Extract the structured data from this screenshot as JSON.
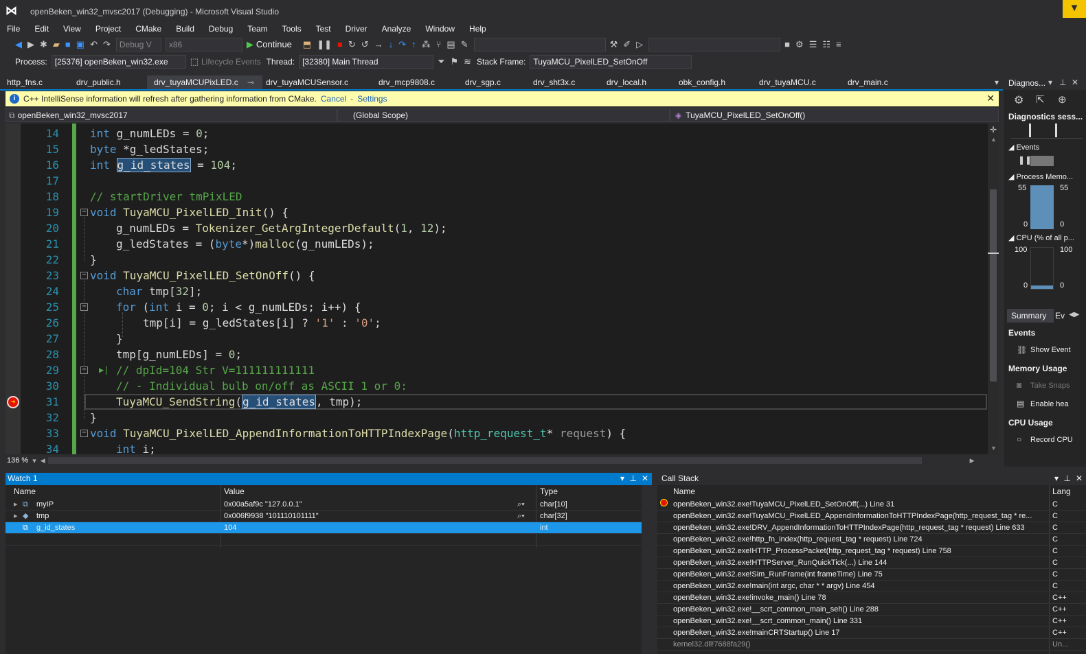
{
  "titlebar": {
    "title": "openBeken_win32_mvsc2017 (Debugging) - Microsoft Visual Studio",
    "notification_icon": "flag-icon"
  },
  "menu": [
    "File",
    "Edit",
    "View",
    "Project",
    "CMake",
    "Build",
    "Debug",
    "Team",
    "Tools",
    "Test",
    "Driver",
    "Analyze",
    "Window",
    "Help"
  ],
  "toolbar": {
    "config": "Debug V",
    "platform": "x86",
    "continue_label": "Continue"
  },
  "debug_location": {
    "process_label": "Process:",
    "process_value": "[25376] openBeken_win32.exe",
    "lifecycle_label": "Lifecycle Events",
    "thread_label": "Thread:",
    "thread_value": "[32380] Main Thread",
    "stack_frame_label": "Stack Frame:",
    "stack_frame_value": "TuyaMCU_PixelLED_SetOnOff"
  },
  "tabs": [
    {
      "label": "http_fns.c",
      "active": false
    },
    {
      "label": "drv_public.h",
      "active": false
    },
    {
      "label": "drv_tuyaMCUPixLED.c",
      "active": true
    },
    {
      "label": "drv_tuyaMCUSensor.c",
      "active": false
    },
    {
      "label": "drv_mcp9808.c",
      "active": false
    },
    {
      "label": "drv_sgp.c",
      "active": false
    },
    {
      "label": "drv_sht3x.c",
      "active": false
    },
    {
      "label": "drv_local.h",
      "active": false
    },
    {
      "label": "obk_config.h",
      "active": false
    },
    {
      "label": "drv_tuyaMCU.c",
      "active": false
    },
    {
      "label": "drv_main.c",
      "active": false
    }
  ],
  "infobar": {
    "message": "C++ IntelliSense information will refresh after gathering information from CMake.",
    "cancel": "Cancel",
    "settings": "Settings"
  },
  "navbar": {
    "project": "openBeken_win32_mvsc2017",
    "scope": "(Global Scope)",
    "member": "TuyaMCU_PixelLED_SetOnOff()"
  },
  "editor": {
    "line_numbers": [
      "14",
      "15",
      "16",
      "17",
      "18",
      "19",
      "20",
      "21",
      "22",
      "23",
      "24",
      "25",
      "26",
      "27",
      "28",
      "29",
      "30",
      "31",
      "32",
      "33",
      "34"
    ],
    "current_line": "31",
    "zoom": "136 %"
  },
  "diagnostics": {
    "title": "Diagnos...",
    "sessions": "Diagnostics sess...",
    "events": "Events",
    "process_memory": "Process Memo...",
    "mem_left_top": "55",
    "mem_right_top": "55",
    "mem_left_bottom": "0",
    "mem_right_bottom": "0",
    "cpu": "CPU (% of all p...",
    "cpu_left_top": "100",
    "cpu_right_top": "100",
    "cpu_left_bottom": "0",
    "cpu_right_bottom": "0",
    "tab_summary": "Summary",
    "tab_events": "Ev",
    "events_heading": "Events",
    "show_events": "Show Event",
    "memory_heading": "Memory Usage",
    "take_snapshot": "Take Snaps",
    "enable_heap": "Enable hea",
    "cpu_heading": "CPU Usage",
    "record_cpu": "Record CPU"
  },
  "watch": {
    "title": "Watch 1",
    "columns": [
      "Name",
      "Value",
      "Type"
    ],
    "rows": [
      {
        "name": "myIP",
        "value": "0x00a5af9c \"127.0.0.1\"",
        "type": "char[10]"
      },
      {
        "name": "tmp",
        "value": "0x006f9938 \"101110101111\"",
        "type": "char[32]"
      },
      {
        "name": "g_id_states",
        "value": "104",
        "type": "int"
      }
    ]
  },
  "callstack": {
    "title": "Call Stack",
    "columns": [
      "Name",
      "Lang"
    ],
    "rows": [
      {
        "name": "openBeken_win32.exe!TuyaMCU_PixelLED_SetOnOff(...) Line 31",
        "lang": "C"
      },
      {
        "name": "openBeken_win32.exe!TuyaMCU_PixelLED_AppendInformationToHTTPIndexPage(http_request_tag * re...",
        "lang": "C"
      },
      {
        "name": "openBeken_win32.exe!DRV_AppendInformationToHTTPIndexPage(http_request_tag * request) Line 633",
        "lang": "C"
      },
      {
        "name": "openBeken_win32.exe!http_fn_index(http_request_tag * request) Line 724",
        "lang": "C"
      },
      {
        "name": "openBeken_win32.exe!HTTP_ProcessPacket(http_request_tag * request) Line 758",
        "lang": "C"
      },
      {
        "name": "openBeken_win32.exe!HTTPServer_RunQuickTick(...) Line 144",
        "lang": "C"
      },
      {
        "name": "openBeken_win32.exe!Sim_RunFrame(int frameTime) Line 75",
        "lang": "C"
      },
      {
        "name": "openBeken_win32.exe!main(int argc, char * * argv) Line 454",
        "lang": "C"
      },
      {
        "name": "openBeken_win32.exe!invoke_main() Line 78",
        "lang": "C++"
      },
      {
        "name": "openBeken_win32.exe!__scrt_common_main_seh() Line 288",
        "lang": "C++"
      },
      {
        "name": "openBeken_win32.exe!__scrt_common_main() Line 331",
        "lang": "C++"
      },
      {
        "name": "openBeken_win32.exe!mainCRTStartup() Line 17",
        "lang": "C++"
      },
      {
        "name": "kernel32.dll!7688fa29()",
        "lang": "Un..."
      }
    ]
  },
  "code": {
    "l14": {
      "a": "int",
      "b": " g_numLEDs = ",
      "c": "0",
      ";": ";"
    },
    "l15": {
      "a": "byte",
      "b": " *g_ledStates;"
    },
    "l16": {
      "a": "int",
      "b": " ",
      "c": "g_id_states",
      "d": " = ",
      "e": "104",
      ";": ";"
    },
    "l18": {
      "a": "// startDriver tmPixLED"
    },
    "l19": {
      "a": "void",
      "b": " ",
      "c": "TuyaMCU_PixelLED_Init",
      "d": "() {"
    },
    "l20": {
      "a": "g_numLEDs = ",
      "b": "Tokenizer_GetArgIntegerDefault",
      "c": "(",
      "d": "1",
      ",": ", ",
      "e": "12",
      ")": ");"
    },
    "l21": {
      "a": "g_ledStates = (",
      "b": "byte",
      "c": "*)",
      "d": "malloc",
      "e": "(g_numLEDs);"
    },
    "l22": {
      "a": "}"
    },
    "l23": {
      "a": "void",
      "b": " ",
      "c": "TuyaMCU_PixelLED_SetOnOff",
      "d": "() {"
    },
    "l24": {
      "a": "char",
      "b": " tmp[",
      "c": "32",
      "d": "];"
    },
    "l25": {
      "a": "for",
      "b": " (",
      "c": "int",
      "d": " i = ",
      "e": "0",
      "f": "; i < g_numLEDs; i++) {"
    },
    "l26": {
      "a": "tmp[i] = g_ledStates[i] ? ",
      "b": "'1'",
      "c": " : ",
      "d": "'0'",
      "e": ";"
    },
    "l27": {
      "a": "}"
    },
    "l28": {
      "a": "tmp[g_numLEDs] = ",
      "b": "0",
      "c": ";"
    },
    "l29": {
      "a": "// dpId=104 Str V=111111111111"
    },
    "l30": {
      "a": "// - Individual bulb on/off as ASCII 1 or 0:"
    },
    "l31": {
      "a": "TuyaMCU_SendString",
      "b": "(",
      "c": "g_id_states",
      "d": ", tmp);"
    },
    "l32": {
      "a": "}"
    },
    "l33": {
      "a": "void",
      "b": " ",
      "c": "TuyaMCU_PixelLED_AppendInformationToHTTPIndexPage",
      "d": "(",
      "e": "http_request_t",
      "f": "* ",
      "g": "request",
      "h": ") {"
    },
    "l34": {
      "a": "int",
      "b": " i;"
    }
  },
  "colors": {
    "accent": "#007acc",
    "breakpoint": "#e51400",
    "keyword": "#569cd6",
    "comment": "#57a64a",
    "type": "#4ec9b0",
    "function": "#dcdcaa"
  }
}
